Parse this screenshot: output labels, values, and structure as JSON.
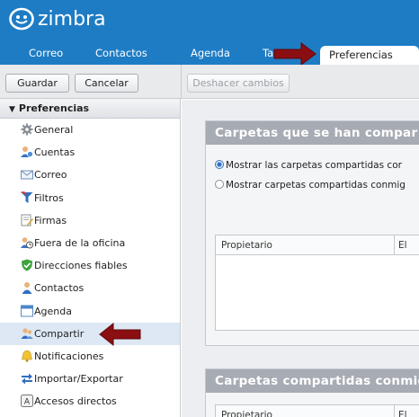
{
  "app": {
    "logo_text": "zimbra"
  },
  "nav": {
    "tabs": [
      {
        "label": "Correo"
      },
      {
        "label": "Contactos"
      },
      {
        "label": "Agenda"
      },
      {
        "label": "Ta"
      },
      {
        "label": "Preferencias"
      }
    ]
  },
  "toolbar": {
    "save_label": "Guardar",
    "cancel_label": "Cancelar",
    "undo_label": "Deshacer cambios"
  },
  "sidebar": {
    "section_title": "Preferencias",
    "items": [
      {
        "label": "General",
        "icon": "gear-icon"
      },
      {
        "label": "Cuentas",
        "icon": "accounts-icon"
      },
      {
        "label": "Correo",
        "icon": "mail-icon"
      },
      {
        "label": "Filtros",
        "icon": "filter-icon"
      },
      {
        "label": "Firmas",
        "icon": "signature-icon"
      },
      {
        "label": "Fuera de la oficina",
        "icon": "out-of-office-icon"
      },
      {
        "label": "Direcciones fiables",
        "icon": "shield-check-icon"
      },
      {
        "label": "Contactos",
        "icon": "contact-icon"
      },
      {
        "label": "Agenda",
        "icon": "calendar-icon"
      },
      {
        "label": "Compartir",
        "icon": "share-icon",
        "selected": true
      },
      {
        "label": "Notificaciones",
        "icon": "bell-icon"
      },
      {
        "label": "Importar/Exportar",
        "icon": "import-export-icon"
      },
      {
        "label": "Accesos directos",
        "icon": "keyboard-icon"
      }
    ]
  },
  "main": {
    "panel1": {
      "title": "Carpetas que se han compar",
      "option1": "Mostrar las carpetas compartidas cor",
      "option2": "Mostrar carpetas compartidas conmig",
      "table_col1": "Propietario",
      "table_col2": "El"
    },
    "panel2": {
      "title": "Carpetas compartidas conmig",
      "table_col1": "Propietario",
      "table_col2": "El"
    }
  },
  "colors": {
    "header_blue": "#1e7cc4",
    "panel_title_gray": "#a7abb3",
    "selected_row": "#dde8f4",
    "annotation_arrow": "#8b0e12"
  }
}
